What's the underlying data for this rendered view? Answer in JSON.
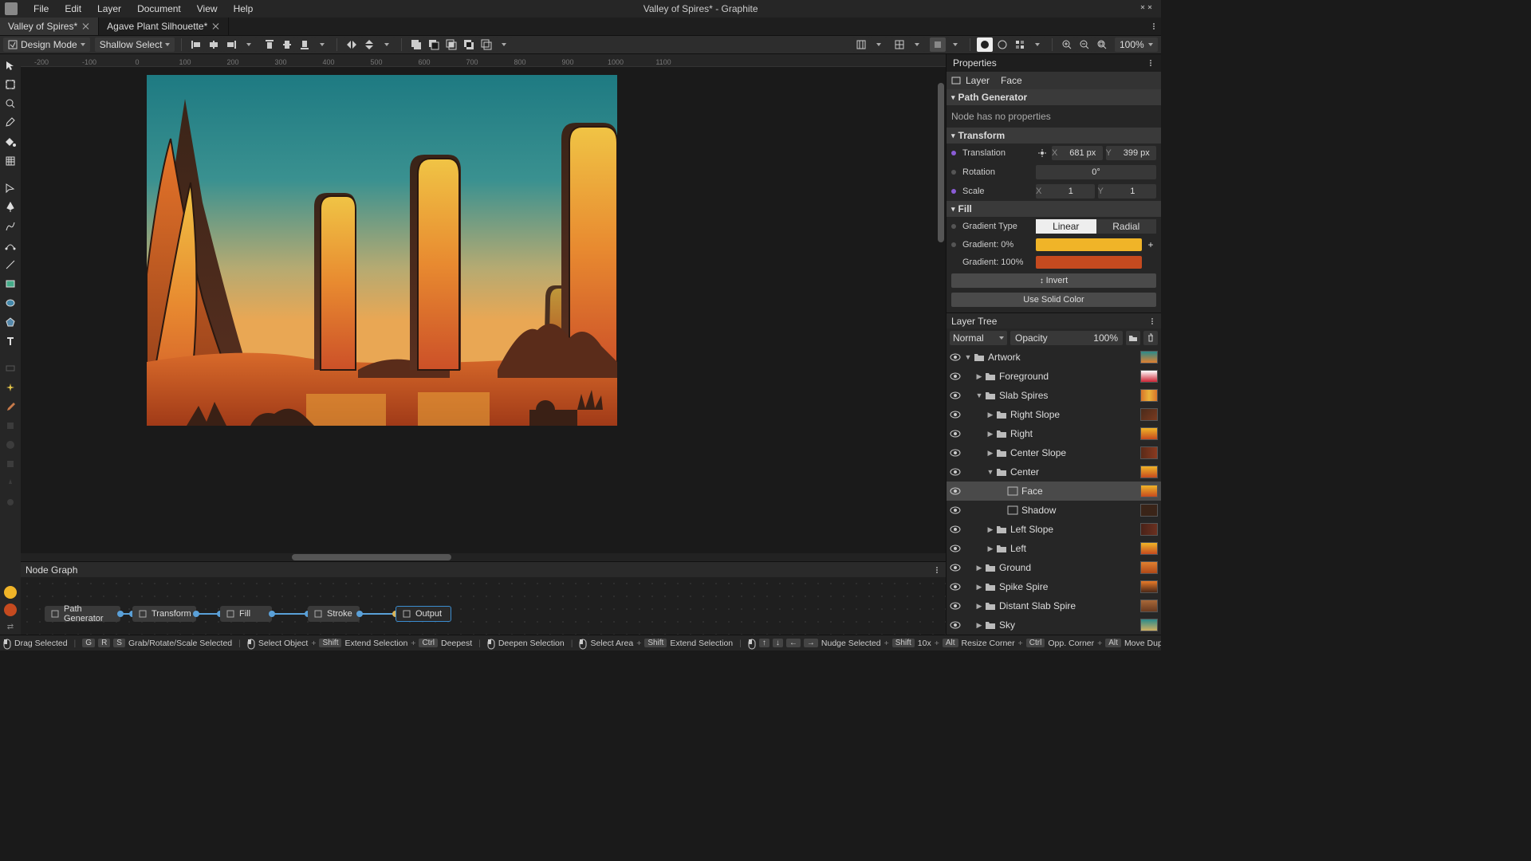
{
  "app": {
    "title": "Valley of Spires* - Graphite"
  },
  "menu": [
    "File",
    "Edit",
    "Layer",
    "Document",
    "View",
    "Help"
  ],
  "tabs": [
    {
      "label": "Valley of Spires*",
      "active": true
    },
    {
      "label": "Agave Plant Silhouette*",
      "active": false
    }
  ],
  "toolbar": {
    "design_mode": "Design Mode",
    "select_depth": "Shallow Select",
    "zoom": "100%"
  },
  "ruler_ticks": [
    "-200",
    "-100",
    "0",
    "100",
    "200",
    "300",
    "400",
    "500",
    "600",
    "700",
    "800",
    "900",
    "1000",
    "1100"
  ],
  "nodegraph": {
    "title": "Node Graph",
    "nodes": [
      "Path Generator",
      "Transform",
      "Fill",
      "Stroke",
      "Output"
    ]
  },
  "properties": {
    "panel_title": "Properties",
    "crumb_layer": "Layer",
    "crumb_leaf": "Face",
    "sec_pathgen": "Path Generator",
    "pathgen_empty": "Node has no properties",
    "sec_transform": "Transform",
    "translation_lbl": "Translation",
    "tx": "681 px",
    "ty": "399 px",
    "rotation_lbl": "Rotation",
    "rotation": "0°",
    "scale_lbl": "Scale",
    "sx": "1",
    "sy": "1",
    "sec_fill": "Fill",
    "gradtype_lbl": "Gradient Type",
    "gradtype_linear": "Linear",
    "gradtype_radial": "Radial",
    "stop0_lbl": "Gradient: 0%",
    "stop1_lbl": "Gradient: 100%",
    "invert": "Invert",
    "solid": "Use Solid Color"
  },
  "layertree": {
    "title": "Layer Tree",
    "blend": "Normal",
    "opacity_lbl": "Opacity",
    "opacity": "100%",
    "layers": [
      {
        "name": "Artwork",
        "depth": 0,
        "folder": true,
        "expanded": true,
        "thumb": "linear-gradient(to bottom,#2a8a8a,#e08030)"
      },
      {
        "name": "Foreground",
        "depth": 1,
        "folder": true,
        "expanded": false,
        "thumb": "linear-gradient(to bottom,#fff,#c23)"
      },
      {
        "name": "Slab Spires",
        "depth": 1,
        "folder": true,
        "expanded": true,
        "thumb": "linear-gradient(to right,#d8752a,#eab23a,#d8752a)"
      },
      {
        "name": "Right Slope",
        "depth": 2,
        "folder": true,
        "expanded": false,
        "thumb": "linear-gradient(135deg,#4a2a1a,#7a3a1f)"
      },
      {
        "name": "Right",
        "depth": 2,
        "folder": true,
        "expanded": false,
        "thumb": "linear-gradient(to bottom,#f0b428,#c54a1f)"
      },
      {
        "name": "Center Slope",
        "depth": 2,
        "folder": true,
        "expanded": false,
        "thumb": "linear-gradient(to right,#5a2a18,#8a3a20)"
      },
      {
        "name": "Center",
        "depth": 2,
        "folder": true,
        "expanded": true,
        "thumb": "linear-gradient(to bottom,#f0b428,#c54a1f)"
      },
      {
        "name": "Face",
        "depth": 3,
        "folder": false,
        "selected": true,
        "thumb": "linear-gradient(to bottom,#f0b428,#c54a1f)"
      },
      {
        "name": "Shadow",
        "depth": 3,
        "folder": false,
        "thumb": "#3a2418"
      },
      {
        "name": "Left Slope",
        "depth": 2,
        "folder": true,
        "expanded": false,
        "thumb": "linear-gradient(to right,#4a2218,#6a3020)"
      },
      {
        "name": "Left",
        "depth": 2,
        "folder": true,
        "expanded": false,
        "thumb": "linear-gradient(to bottom,#f0b428,#c54a1f)"
      },
      {
        "name": "Ground",
        "depth": 1,
        "folder": true,
        "expanded": false,
        "thumb": "linear-gradient(to bottom,#e08030,#b04818)"
      },
      {
        "name": "Spike Spire",
        "depth": 1,
        "folder": true,
        "expanded": false,
        "thumb": "linear-gradient(to bottom,#e87a28,#4a2818)"
      },
      {
        "name": "Distant Slab Spire",
        "depth": 1,
        "folder": true,
        "expanded": false,
        "thumb": "linear-gradient(to bottom,#a86838,#6a3a20)"
      },
      {
        "name": "Sky",
        "depth": 1,
        "folder": true,
        "expanded": false,
        "thumb": "linear-gradient(to bottom,#2a8a8a,#d0b060)"
      }
    ]
  },
  "status": {
    "items": [
      {
        "t": "Drag Selected"
      },
      {
        "keys": [
          "G",
          "R",
          "S"
        ],
        "t": "Grab/Rotate/Scale Selected"
      },
      {
        "t": "Select Object",
        "plus": true
      },
      {
        "keys": [
          "Shift"
        ],
        "t": "Extend Selection",
        "plus": true
      },
      {
        "keys": [
          "Ctrl"
        ],
        "t": "Deepest"
      },
      {
        "t": "Deepen Selection"
      },
      {
        "t": "Select Area",
        "plus": true
      },
      {
        "keys": [
          "Shift"
        ],
        "t": "Extend Selection"
      },
      {
        "t": "Nudge Selected",
        "plus": true
      },
      {
        "keys": [
          "Shift"
        ],
        "t": "10x",
        "plus": true
      },
      {
        "keys": [
          "Alt"
        ],
        "t": "Resize Corner",
        "plus": true
      },
      {
        "keys": [
          "Ctrl"
        ],
        "t": "Opp. Corner",
        "plus": true
      },
      {
        "keys": [
          "Alt"
        ],
        "t": "Move Duplicate"
      }
    ]
  }
}
